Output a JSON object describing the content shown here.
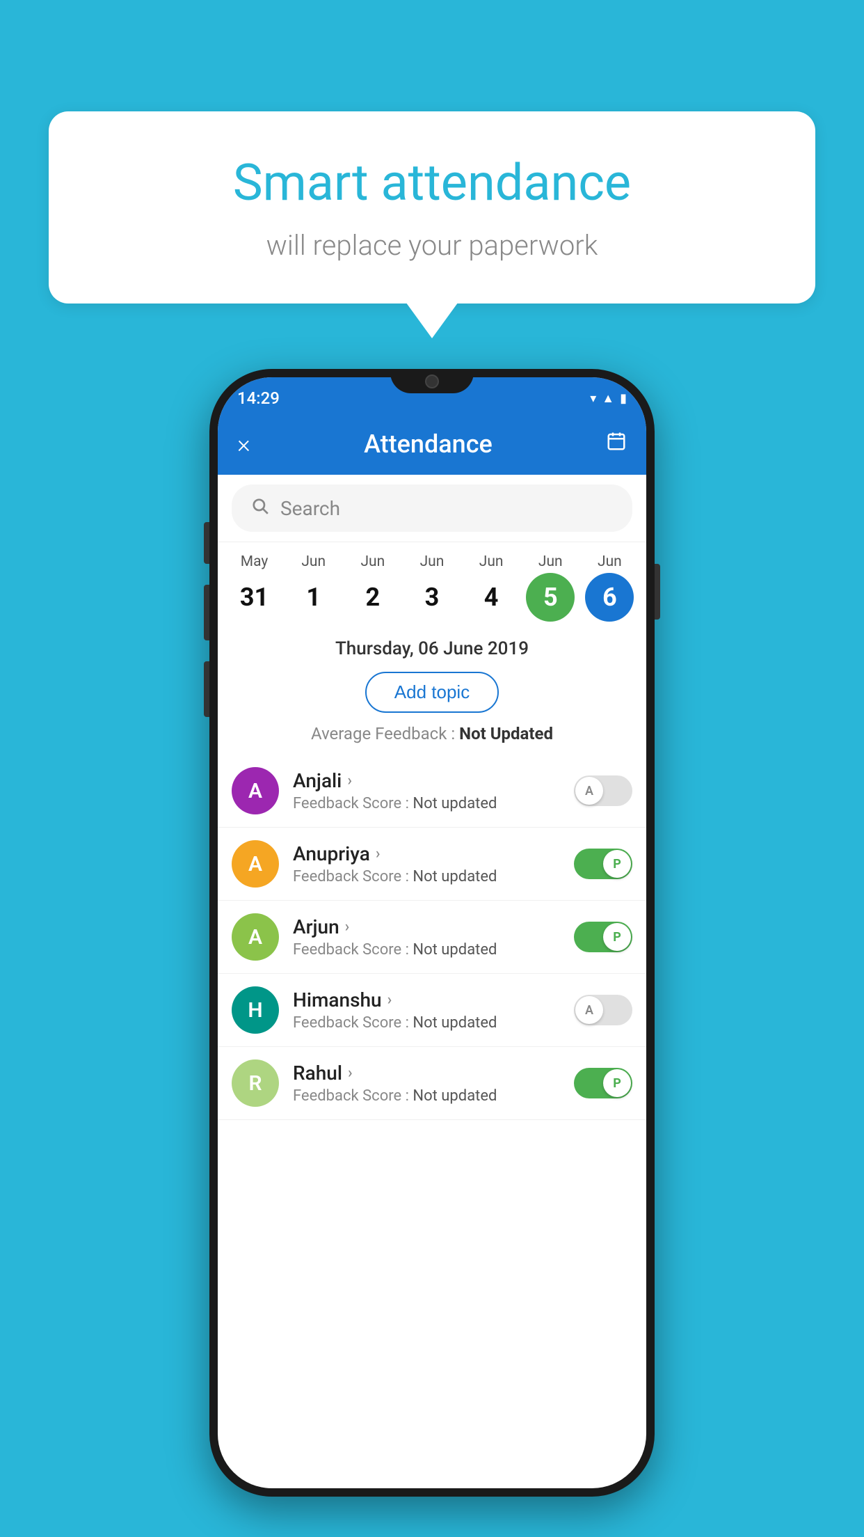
{
  "background_color": "#29b6d8",
  "speech_bubble": {
    "title": "Smart attendance",
    "subtitle": "will replace your paperwork"
  },
  "status_bar": {
    "time": "14:29",
    "icons": [
      "wifi",
      "signal",
      "battery"
    ]
  },
  "header": {
    "title": "Attendance",
    "close_label": "×",
    "calendar_icon": "📅"
  },
  "search": {
    "placeholder": "Search"
  },
  "date_strip": {
    "dates": [
      {
        "month": "May",
        "day": "31",
        "style": "normal"
      },
      {
        "month": "Jun",
        "day": "1",
        "style": "normal"
      },
      {
        "month": "Jun",
        "day": "2",
        "style": "normal"
      },
      {
        "month": "Jun",
        "day": "3",
        "style": "normal"
      },
      {
        "month": "Jun",
        "day": "4",
        "style": "normal"
      },
      {
        "month": "Jun",
        "day": "5",
        "style": "green"
      },
      {
        "month": "Jun",
        "day": "6",
        "style": "blue"
      }
    ]
  },
  "selected_date": {
    "text": "Thursday, 06 June 2019",
    "add_topic_label": "Add topic",
    "avg_feedback_label": "Average Feedback :",
    "avg_feedback_value": "Not Updated"
  },
  "students": [
    {
      "name": "Anjali",
      "avatar_letter": "A",
      "avatar_color": "purple",
      "feedback_label": "Feedback Score :",
      "feedback_value": "Not updated",
      "attendance": "absent"
    },
    {
      "name": "Anupriya",
      "avatar_letter": "A",
      "avatar_color": "yellow",
      "feedback_label": "Feedback Score :",
      "feedback_value": "Not updated",
      "attendance": "present"
    },
    {
      "name": "Arjun",
      "avatar_letter": "A",
      "avatar_color": "green",
      "feedback_label": "Feedback Score :",
      "feedback_value": "Not updated",
      "attendance": "present"
    },
    {
      "name": "Himanshu",
      "avatar_letter": "H",
      "avatar_color": "teal",
      "feedback_label": "Feedback Score :",
      "feedback_value": "Not updated",
      "attendance": "absent"
    },
    {
      "name": "Rahul",
      "avatar_letter": "R",
      "avatar_color": "lightgreen",
      "feedback_label": "Feedback Score :",
      "feedback_value": "Not updated",
      "attendance": "present"
    }
  ]
}
